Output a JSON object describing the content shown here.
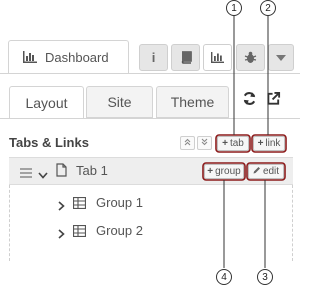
{
  "sidebar": {
    "main_tab_label": "Dashboard",
    "icon_buttons": [
      "info-icon",
      "book-icon",
      "dashboard-chart-icon",
      "bug-icon",
      "dropdown-caret-icon"
    ],
    "info_glyph": "i"
  },
  "subtabs": {
    "layout": "Layout",
    "site": "Site",
    "theme": "Theme"
  },
  "section": {
    "title": "Tabs & Links",
    "add_tab_label": "tab",
    "add_link_label": "link"
  },
  "tree": {
    "tab": {
      "label": "Tab 1",
      "add_group_label": "group",
      "edit_label": "edit"
    },
    "groups": [
      "Group 1",
      "Group 2"
    ]
  },
  "callouts": [
    "1",
    "2",
    "3",
    "4"
  ],
  "colors": {
    "highlight": "#8b1a1a",
    "callout_line": "#333333"
  }
}
